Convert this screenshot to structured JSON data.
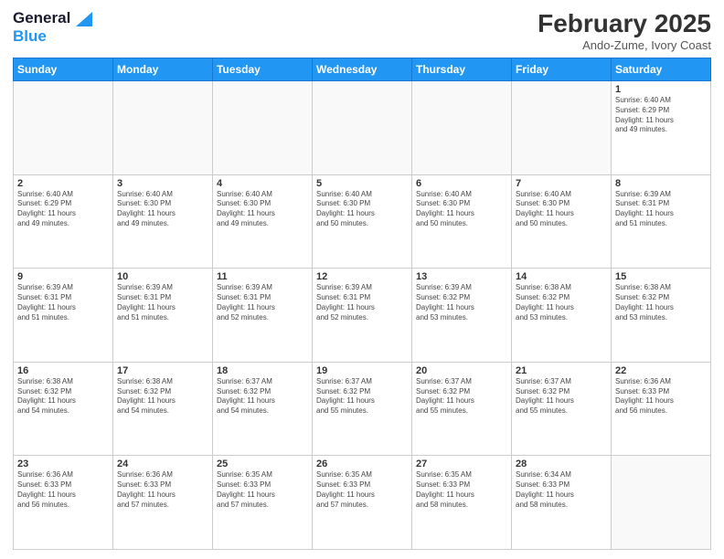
{
  "header": {
    "logo_line1": "General",
    "logo_line2": "Blue",
    "title": "February 2025",
    "subtitle": "Ando-Zume, Ivory Coast"
  },
  "weekdays": [
    "Sunday",
    "Monday",
    "Tuesday",
    "Wednesday",
    "Thursday",
    "Friday",
    "Saturday"
  ],
  "weeks": [
    [
      {
        "day": "",
        "info": ""
      },
      {
        "day": "",
        "info": ""
      },
      {
        "day": "",
        "info": ""
      },
      {
        "day": "",
        "info": ""
      },
      {
        "day": "",
        "info": ""
      },
      {
        "day": "",
        "info": ""
      },
      {
        "day": "1",
        "info": "Sunrise: 6:40 AM\nSunset: 6:29 PM\nDaylight: 11 hours\nand 49 minutes."
      }
    ],
    [
      {
        "day": "2",
        "info": "Sunrise: 6:40 AM\nSunset: 6:29 PM\nDaylight: 11 hours\nand 49 minutes."
      },
      {
        "day": "3",
        "info": "Sunrise: 6:40 AM\nSunset: 6:30 PM\nDaylight: 11 hours\nand 49 minutes."
      },
      {
        "day": "4",
        "info": "Sunrise: 6:40 AM\nSunset: 6:30 PM\nDaylight: 11 hours\nand 49 minutes."
      },
      {
        "day": "5",
        "info": "Sunrise: 6:40 AM\nSunset: 6:30 PM\nDaylight: 11 hours\nand 50 minutes."
      },
      {
        "day": "6",
        "info": "Sunrise: 6:40 AM\nSunset: 6:30 PM\nDaylight: 11 hours\nand 50 minutes."
      },
      {
        "day": "7",
        "info": "Sunrise: 6:40 AM\nSunset: 6:30 PM\nDaylight: 11 hours\nand 50 minutes."
      },
      {
        "day": "8",
        "info": "Sunrise: 6:39 AM\nSunset: 6:31 PM\nDaylight: 11 hours\nand 51 minutes."
      }
    ],
    [
      {
        "day": "9",
        "info": "Sunrise: 6:39 AM\nSunset: 6:31 PM\nDaylight: 11 hours\nand 51 minutes."
      },
      {
        "day": "10",
        "info": "Sunrise: 6:39 AM\nSunset: 6:31 PM\nDaylight: 11 hours\nand 51 minutes."
      },
      {
        "day": "11",
        "info": "Sunrise: 6:39 AM\nSunset: 6:31 PM\nDaylight: 11 hours\nand 52 minutes."
      },
      {
        "day": "12",
        "info": "Sunrise: 6:39 AM\nSunset: 6:31 PM\nDaylight: 11 hours\nand 52 minutes."
      },
      {
        "day": "13",
        "info": "Sunrise: 6:39 AM\nSunset: 6:32 PM\nDaylight: 11 hours\nand 53 minutes."
      },
      {
        "day": "14",
        "info": "Sunrise: 6:38 AM\nSunset: 6:32 PM\nDaylight: 11 hours\nand 53 minutes."
      },
      {
        "day": "15",
        "info": "Sunrise: 6:38 AM\nSunset: 6:32 PM\nDaylight: 11 hours\nand 53 minutes."
      }
    ],
    [
      {
        "day": "16",
        "info": "Sunrise: 6:38 AM\nSunset: 6:32 PM\nDaylight: 11 hours\nand 54 minutes."
      },
      {
        "day": "17",
        "info": "Sunrise: 6:38 AM\nSunset: 6:32 PM\nDaylight: 11 hours\nand 54 minutes."
      },
      {
        "day": "18",
        "info": "Sunrise: 6:37 AM\nSunset: 6:32 PM\nDaylight: 11 hours\nand 54 minutes."
      },
      {
        "day": "19",
        "info": "Sunrise: 6:37 AM\nSunset: 6:32 PM\nDaylight: 11 hours\nand 55 minutes."
      },
      {
        "day": "20",
        "info": "Sunrise: 6:37 AM\nSunset: 6:32 PM\nDaylight: 11 hours\nand 55 minutes."
      },
      {
        "day": "21",
        "info": "Sunrise: 6:37 AM\nSunset: 6:32 PM\nDaylight: 11 hours\nand 55 minutes."
      },
      {
        "day": "22",
        "info": "Sunrise: 6:36 AM\nSunset: 6:33 PM\nDaylight: 11 hours\nand 56 minutes."
      }
    ],
    [
      {
        "day": "23",
        "info": "Sunrise: 6:36 AM\nSunset: 6:33 PM\nDaylight: 11 hours\nand 56 minutes."
      },
      {
        "day": "24",
        "info": "Sunrise: 6:36 AM\nSunset: 6:33 PM\nDaylight: 11 hours\nand 57 minutes."
      },
      {
        "day": "25",
        "info": "Sunrise: 6:35 AM\nSunset: 6:33 PM\nDaylight: 11 hours\nand 57 minutes."
      },
      {
        "day": "26",
        "info": "Sunrise: 6:35 AM\nSunset: 6:33 PM\nDaylight: 11 hours\nand 57 minutes."
      },
      {
        "day": "27",
        "info": "Sunrise: 6:35 AM\nSunset: 6:33 PM\nDaylight: 11 hours\nand 58 minutes."
      },
      {
        "day": "28",
        "info": "Sunrise: 6:34 AM\nSunset: 6:33 PM\nDaylight: 11 hours\nand 58 minutes."
      },
      {
        "day": "",
        "info": ""
      }
    ]
  ]
}
